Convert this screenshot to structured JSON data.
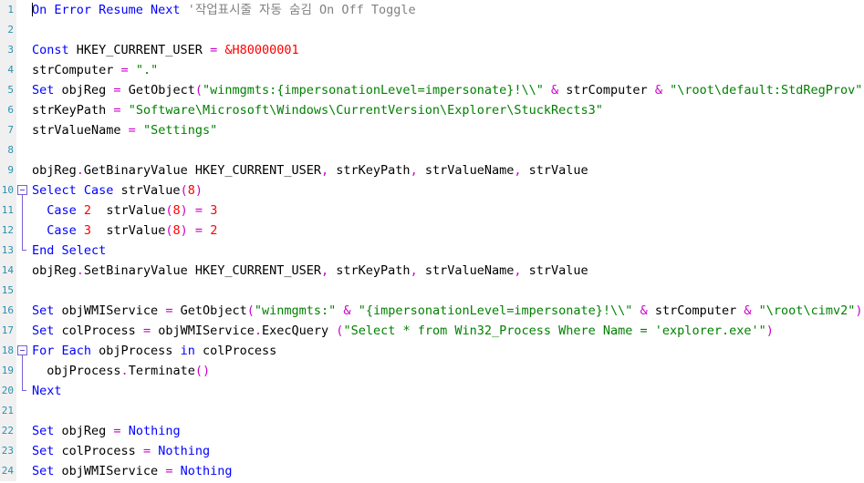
{
  "editor": {
    "language": "VBScript",
    "background": "#ffffff",
    "gutter_background": "#f0f0f0",
    "line_number_color": "#2b91af",
    "colors": {
      "keyword": "#0000ff",
      "string": "#008000",
      "number": "#ff0000",
      "operator": "#cc00cc",
      "comment": "#808080",
      "identifier": "#000000",
      "fold_marker": "#7a5fd3"
    },
    "caret": {
      "line": 1,
      "column": 1
    },
    "total_lines": 24,
    "lines": [
      {
        "number": "1",
        "fold": "none",
        "caret": true,
        "tokens": [
          {
            "text": "On Error Resume Next",
            "type": "keyword"
          },
          {
            "text": " ",
            "type": "plain"
          },
          {
            "text": "'작업표시줄 자동 숨김 On Off Toggle",
            "type": "comment"
          }
        ]
      },
      {
        "number": "2",
        "fold": "none",
        "tokens": []
      },
      {
        "number": "3",
        "fold": "none",
        "tokens": [
          {
            "text": "Const",
            "type": "keyword"
          },
          {
            "text": " HKEY_CURRENT_USER ",
            "type": "identifier"
          },
          {
            "text": "=",
            "type": "operator"
          },
          {
            "text": " ",
            "type": "plain"
          },
          {
            "text": "&H80000001",
            "type": "number"
          }
        ]
      },
      {
        "number": "4",
        "fold": "none",
        "tokens": [
          {
            "text": "strComputer ",
            "type": "identifier"
          },
          {
            "text": "=",
            "type": "operator"
          },
          {
            "text": " ",
            "type": "plain"
          },
          {
            "text": "\".\"",
            "type": "string"
          }
        ]
      },
      {
        "number": "5",
        "fold": "none",
        "tokens": [
          {
            "text": "Set",
            "type": "keyword"
          },
          {
            "text": " objReg ",
            "type": "identifier"
          },
          {
            "text": "=",
            "type": "operator"
          },
          {
            "text": " GetObject",
            "type": "identifier"
          },
          {
            "text": "(",
            "type": "operator"
          },
          {
            "text": "\"winmgmts:{impersonationLevel=impersonate}!\\\\\"",
            "type": "string"
          },
          {
            "text": " ",
            "type": "plain"
          },
          {
            "text": "&",
            "type": "operator"
          },
          {
            "text": " strComputer ",
            "type": "identifier"
          },
          {
            "text": "&",
            "type": "operator"
          },
          {
            "text": " ",
            "type": "plain"
          },
          {
            "text": "\"\\root\\default:StdRegProv\"",
            "type": "string"
          },
          {
            "text": ")",
            "type": "operator"
          }
        ]
      },
      {
        "number": "6",
        "fold": "none",
        "tokens": [
          {
            "text": "strKeyPath ",
            "type": "identifier"
          },
          {
            "text": "=",
            "type": "operator"
          },
          {
            "text": " ",
            "type": "plain"
          },
          {
            "text": "\"Software\\Microsoft\\Windows\\CurrentVersion\\Explorer\\StuckRects3\"",
            "type": "string"
          }
        ]
      },
      {
        "number": "7",
        "fold": "none",
        "tokens": [
          {
            "text": "strValueName ",
            "type": "identifier"
          },
          {
            "text": "=",
            "type": "operator"
          },
          {
            "text": " ",
            "type": "plain"
          },
          {
            "text": "\"Settings\"",
            "type": "string"
          }
        ]
      },
      {
        "number": "8",
        "fold": "none",
        "tokens": []
      },
      {
        "number": "9",
        "fold": "none",
        "tokens": [
          {
            "text": "objReg",
            "type": "identifier"
          },
          {
            "text": ".",
            "type": "operator"
          },
          {
            "text": "GetBinaryValue HKEY_CURRENT_USER",
            "type": "identifier"
          },
          {
            "text": ",",
            "type": "operator"
          },
          {
            "text": " strKeyPath",
            "type": "identifier"
          },
          {
            "text": ",",
            "type": "operator"
          },
          {
            "text": " strValueName",
            "type": "identifier"
          },
          {
            "text": ",",
            "type": "operator"
          },
          {
            "text": " strValue",
            "type": "identifier"
          }
        ]
      },
      {
        "number": "10",
        "fold": "start",
        "tokens": [
          {
            "text": "Select Case",
            "type": "keyword"
          },
          {
            "text": " strValue",
            "type": "identifier"
          },
          {
            "text": "(",
            "type": "operator"
          },
          {
            "text": "8",
            "type": "number"
          },
          {
            "text": ")",
            "type": "operator"
          }
        ]
      },
      {
        "number": "11",
        "fold": "mid",
        "tokens": [
          {
            "text": "  ",
            "type": "plain"
          },
          {
            "text": "Case",
            "type": "keyword"
          },
          {
            "text": " ",
            "type": "plain"
          },
          {
            "text": "2",
            "type": "number"
          },
          {
            "text": "  strValue",
            "type": "identifier"
          },
          {
            "text": "(",
            "type": "operator"
          },
          {
            "text": "8",
            "type": "number"
          },
          {
            "text": ")",
            "type": "operator"
          },
          {
            "text": " ",
            "type": "plain"
          },
          {
            "text": "=",
            "type": "operator"
          },
          {
            "text": " ",
            "type": "plain"
          },
          {
            "text": "3",
            "type": "number"
          }
        ]
      },
      {
        "number": "12",
        "fold": "mid",
        "tokens": [
          {
            "text": "  ",
            "type": "plain"
          },
          {
            "text": "Case",
            "type": "keyword"
          },
          {
            "text": " ",
            "type": "plain"
          },
          {
            "text": "3",
            "type": "number"
          },
          {
            "text": "  strValue",
            "type": "identifier"
          },
          {
            "text": "(",
            "type": "operator"
          },
          {
            "text": "8",
            "type": "number"
          },
          {
            "text": ")",
            "type": "operator"
          },
          {
            "text": " ",
            "type": "plain"
          },
          {
            "text": "=",
            "type": "operator"
          },
          {
            "text": " ",
            "type": "plain"
          },
          {
            "text": "2",
            "type": "number"
          }
        ]
      },
      {
        "number": "13",
        "fold": "end",
        "tokens": [
          {
            "text": "End Select",
            "type": "keyword"
          }
        ]
      },
      {
        "number": "14",
        "fold": "none",
        "tokens": [
          {
            "text": "objReg",
            "type": "identifier"
          },
          {
            "text": ".",
            "type": "operator"
          },
          {
            "text": "SetBinaryValue HKEY_CURRENT_USER",
            "type": "identifier"
          },
          {
            "text": ",",
            "type": "operator"
          },
          {
            "text": " strKeyPath",
            "type": "identifier"
          },
          {
            "text": ",",
            "type": "operator"
          },
          {
            "text": " strValueName",
            "type": "identifier"
          },
          {
            "text": ",",
            "type": "operator"
          },
          {
            "text": " strValue",
            "type": "identifier"
          }
        ]
      },
      {
        "number": "15",
        "fold": "none",
        "tokens": []
      },
      {
        "number": "16",
        "fold": "none",
        "tokens": [
          {
            "text": "Set",
            "type": "keyword"
          },
          {
            "text": " objWMIService ",
            "type": "identifier"
          },
          {
            "text": "=",
            "type": "operator"
          },
          {
            "text": " GetObject",
            "type": "identifier"
          },
          {
            "text": "(",
            "type": "operator"
          },
          {
            "text": "\"winmgmts:\"",
            "type": "string"
          },
          {
            "text": " ",
            "type": "plain"
          },
          {
            "text": "&",
            "type": "operator"
          },
          {
            "text": " ",
            "type": "plain"
          },
          {
            "text": "\"{impersonationLevel=impersonate}!\\\\\"",
            "type": "string"
          },
          {
            "text": " ",
            "type": "plain"
          },
          {
            "text": "&",
            "type": "operator"
          },
          {
            "text": " strComputer ",
            "type": "identifier"
          },
          {
            "text": "&",
            "type": "operator"
          },
          {
            "text": " ",
            "type": "plain"
          },
          {
            "text": "\"\\root\\cimv2\"",
            "type": "string"
          },
          {
            "text": ")",
            "type": "operator"
          }
        ]
      },
      {
        "number": "17",
        "fold": "none",
        "tokens": [
          {
            "text": "Set",
            "type": "keyword"
          },
          {
            "text": " colProcess ",
            "type": "identifier"
          },
          {
            "text": "=",
            "type": "operator"
          },
          {
            "text": " objWMIService",
            "type": "identifier"
          },
          {
            "text": ".",
            "type": "operator"
          },
          {
            "text": "ExecQuery ",
            "type": "identifier"
          },
          {
            "text": "(",
            "type": "operator"
          },
          {
            "text": "\"Select * from Win32_Process Where Name = 'explorer.exe'\"",
            "type": "string"
          },
          {
            "text": ")",
            "type": "operator"
          }
        ]
      },
      {
        "number": "18",
        "fold": "start",
        "tokens": [
          {
            "text": "For Each",
            "type": "keyword"
          },
          {
            "text": " objProcess ",
            "type": "identifier"
          },
          {
            "text": "in",
            "type": "keyword"
          },
          {
            "text": " colProcess",
            "type": "identifier"
          }
        ]
      },
      {
        "number": "19",
        "fold": "mid",
        "tokens": [
          {
            "text": "  objProcess",
            "type": "identifier"
          },
          {
            "text": ".",
            "type": "operator"
          },
          {
            "text": "Terminate",
            "type": "identifier"
          },
          {
            "text": "()",
            "type": "operator"
          }
        ]
      },
      {
        "number": "20",
        "fold": "end",
        "tokens": [
          {
            "text": "Next",
            "type": "keyword"
          }
        ]
      },
      {
        "number": "21",
        "fold": "none",
        "tokens": []
      },
      {
        "number": "22",
        "fold": "none",
        "tokens": [
          {
            "text": "Set",
            "type": "keyword"
          },
          {
            "text": " objReg ",
            "type": "identifier"
          },
          {
            "text": "=",
            "type": "operator"
          },
          {
            "text": " ",
            "type": "plain"
          },
          {
            "text": "Nothing",
            "type": "keyword"
          }
        ]
      },
      {
        "number": "23",
        "fold": "none",
        "tokens": [
          {
            "text": "Set",
            "type": "keyword"
          },
          {
            "text": " colProcess ",
            "type": "identifier"
          },
          {
            "text": "=",
            "type": "operator"
          },
          {
            "text": " ",
            "type": "plain"
          },
          {
            "text": "Nothing",
            "type": "keyword"
          }
        ]
      },
      {
        "number": "24",
        "fold": "none",
        "tokens": [
          {
            "text": "Set",
            "type": "keyword"
          },
          {
            "text": " objWMIService ",
            "type": "identifier"
          },
          {
            "text": "=",
            "type": "operator"
          },
          {
            "text": " ",
            "type": "plain"
          },
          {
            "text": "Nothing",
            "type": "keyword"
          }
        ]
      }
    ]
  }
}
